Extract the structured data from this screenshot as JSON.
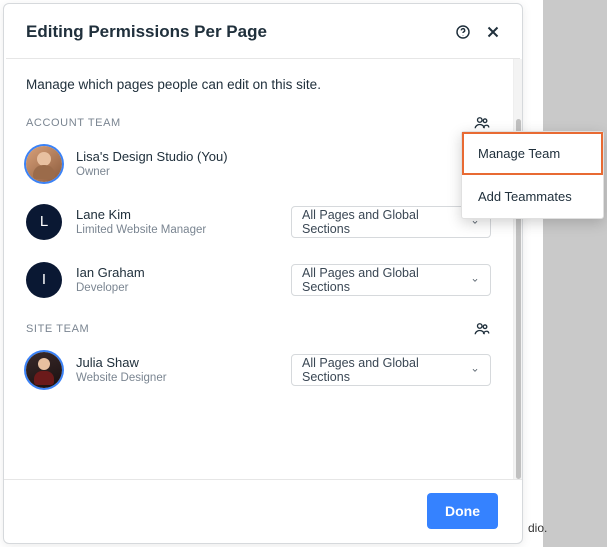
{
  "header": {
    "title": "Editing Permissions Per Page"
  },
  "intro": "Manage which pages people can edit on this site.",
  "sections": {
    "account": {
      "label": "ACCOUNT TEAM",
      "members": [
        {
          "name": "Lisa's Design Studio (You)",
          "role": "Owner"
        },
        {
          "name": "Lane Kim",
          "role": "Limited Website Manager",
          "initial": "L",
          "dropdown": "All Pages and Global Sections"
        },
        {
          "name": "Ian Graham",
          "role": "Developer",
          "initial": "I",
          "dropdown": "All Pages and Global Sections"
        }
      ]
    },
    "site": {
      "label": "SITE TEAM",
      "members": [
        {
          "name": "Julia Shaw",
          "role": "Website Designer",
          "dropdown": "All Pages and Global Sections"
        }
      ]
    }
  },
  "menu": {
    "item1": "Manage Team",
    "item2": "Add Teammates"
  },
  "footer": {
    "done": "Done"
  },
  "backdrop_snippet": "dio."
}
